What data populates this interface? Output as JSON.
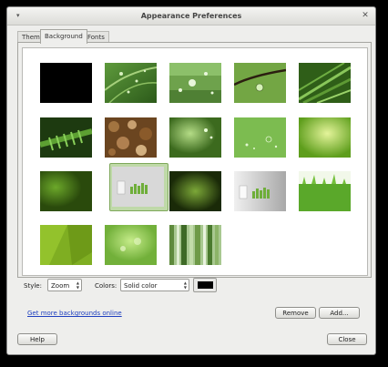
{
  "window": {
    "title": "Appearance Preferences"
  },
  "tabs": [
    {
      "label": "Theme"
    },
    {
      "label": "Background"
    },
    {
      "label": "Fonts"
    }
  ],
  "gallery": {
    "selected_index": 6
  },
  "style_field": {
    "label": "Style:",
    "value": "Zoom"
  },
  "colors_field": {
    "label": "Colors:",
    "value": "Solid color",
    "swatch": "#000000"
  },
  "link": {
    "label": "Get more backgrounds online"
  },
  "buttons": {
    "remove": "Remove",
    "add": "Add...",
    "help": "Help",
    "close": "Close"
  },
  "colors": {
    "accent_link": "#1e3fbf",
    "selection": "#bfd9a8"
  }
}
